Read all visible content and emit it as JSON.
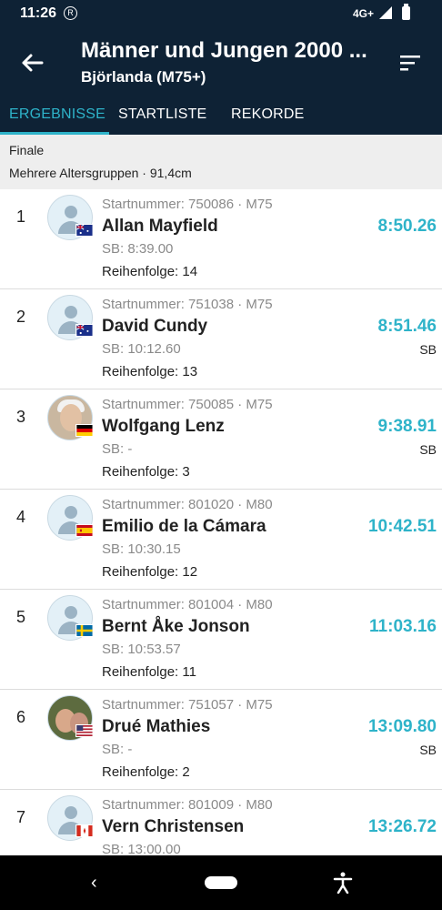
{
  "status": {
    "time": "11:26",
    "network": "4G+"
  },
  "header": {
    "title": "Männer und Jungen 2000 ...",
    "subtitle": "Björlanda (M75+)"
  },
  "tabs": [
    {
      "label": "ERGEBNISSE",
      "active": true
    },
    {
      "label": "STARTLISTE",
      "active": false
    },
    {
      "label": "REKORDE",
      "active": false
    }
  ],
  "heat": {
    "round": "Finale",
    "info": "Mehrere Altersgruppen · 91,4cm"
  },
  "colors": {
    "appbar": "#0e2235",
    "accent": "#2eb3c9"
  },
  "results": [
    {
      "place": "1",
      "start": "Startnummer: 750086 · M75",
      "name": "Allan Mayfield",
      "sb": "SB: 8:39.00",
      "order": "Reihenfolge: 14",
      "time": "8:50.26",
      "tag": "",
      "flag": "australia-flag",
      "avatar": "placeholder"
    },
    {
      "place": "2",
      "start": "Startnummer: 751038 · M75",
      "name": "David Cundy",
      "sb": "SB: 10:12.60",
      "order": "Reihenfolge: 13",
      "time": "8:51.46",
      "tag": "SB",
      "flag": "australia-flag",
      "avatar": "placeholder"
    },
    {
      "place": "3",
      "start": "Startnummer: 750085 · M75",
      "name": "Wolfgang Lenz",
      "sb": "SB: -",
      "order": "Reihenfolge: 3",
      "time": "9:38.91",
      "tag": "SB",
      "flag": "germany-flag",
      "avatar": "photo"
    },
    {
      "place": "4",
      "start": "Startnummer: 801020 · M80",
      "name": "Emilio de la Cámara",
      "sb": "SB: 10:30.15",
      "order": "Reihenfolge: 12",
      "time": "10:42.51",
      "tag": "",
      "flag": "spain-flag",
      "avatar": "placeholder"
    },
    {
      "place": "5",
      "start": "Startnummer: 801004 · M80",
      "name": "Bernt Åke Jonson",
      "sb": "SB: 10:53.57",
      "order": "Reihenfolge: 11",
      "time": "11:03.16",
      "tag": "",
      "flag": "sweden-flag",
      "avatar": "placeholder"
    },
    {
      "place": "6",
      "start": "Startnummer: 751057 · M75",
      "name": "Drué Mathies",
      "sb": "SB: -",
      "order": "Reihenfolge: 2",
      "time": "13:09.80",
      "tag": "SB",
      "flag": "usa-flag",
      "avatar": "photo2"
    },
    {
      "place": "7",
      "start": "Startnummer: 801009 · M80",
      "name": "Vern Christensen",
      "sb": "SB: 13:00.00",
      "order": "",
      "time": "13:26.72",
      "tag": "",
      "flag": "canada-flag",
      "avatar": "placeholder"
    }
  ]
}
